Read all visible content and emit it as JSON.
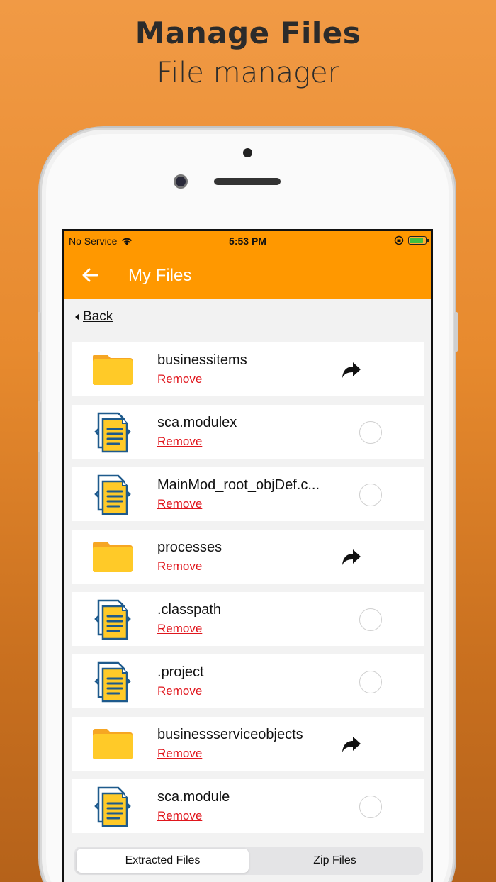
{
  "promo": {
    "title": "Manage Files",
    "subtitle": "File manager"
  },
  "statusbar": {
    "carrier": "No Service",
    "time": "5:53 PM",
    "battery_level": 0.9
  },
  "navbar": {
    "title": "My Files",
    "back_icon": "arrow-left-icon"
  },
  "back_link": {
    "label": "Back"
  },
  "files": [
    {
      "name": "businessitems",
      "type": "folder",
      "remove_label": "Remove"
    },
    {
      "name": "sca.modulex",
      "type": "file",
      "remove_label": "Remove"
    },
    {
      "name": "MainMod_root_objDef.c...",
      "type": "file",
      "remove_label": "Remove"
    },
    {
      "name": "processes",
      "type": "folder",
      "remove_label": "Remove"
    },
    {
      "name": ".classpath",
      "type": "file",
      "remove_label": "Remove"
    },
    {
      "name": ".project",
      "type": "file",
      "remove_label": "Remove"
    },
    {
      "name": "businessserviceobjects",
      "type": "folder",
      "remove_label": "Remove"
    },
    {
      "name": "sca.module",
      "type": "file",
      "remove_label": "Remove"
    }
  ],
  "tabs": [
    {
      "label": "Extracted Files",
      "active": true
    },
    {
      "label": "Zip Files",
      "active": false
    }
  ],
  "colors": {
    "accent": "#ff9800",
    "remove": "#e0161d",
    "folder": "#ffca28",
    "doc_blue": "#1e5a8c"
  }
}
